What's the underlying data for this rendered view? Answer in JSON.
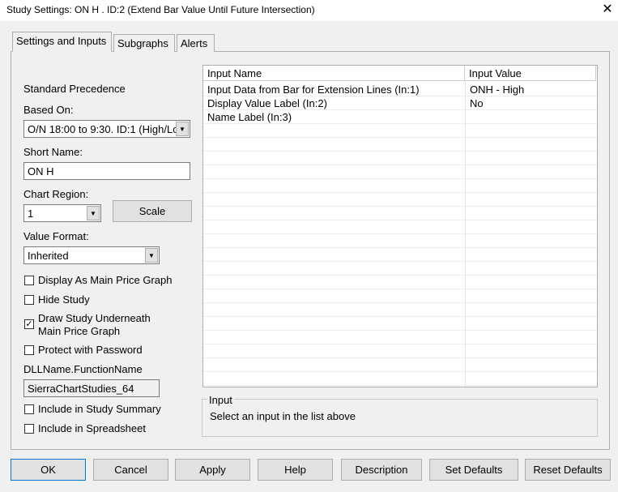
{
  "window": {
    "title": "Study Settings: ON H . ID:2 (Extend Bar Value Until Future Intersection)",
    "close": "✕"
  },
  "tabs": [
    "Settings and Inputs",
    "Subgraphs",
    "Alerts"
  ],
  "left": {
    "standard_precedence": "Standard Precedence",
    "based_on_label": "Based On:",
    "based_on_value": "O/N 18:00 to 9:30. ID:1 (High/Low",
    "short_name_label": "Short Name:",
    "short_name_value": "ON H",
    "chart_region_label": "Chart Region:",
    "chart_region_value": "1",
    "scale": "Scale",
    "value_format_label": "Value Format:",
    "value_format_value": "Inherited",
    "checkboxes": [
      {
        "label": "Display As Main Price Graph",
        "checked": false
      },
      {
        "label": "Hide Study",
        "checked": false
      },
      {
        "label": "Draw Study Underneath\nMain Price Graph",
        "checked": true
      },
      {
        "label": "Protect with Password",
        "checked": false
      }
    ],
    "dll_label": "DLLName.FunctionName",
    "dll_value": "SierraChartStudies_64",
    "checkboxes2": [
      {
        "label": "Include in Study Summary",
        "checked": false
      },
      {
        "label": "Include in Spreadsheet",
        "checked": false
      }
    ]
  },
  "grid": {
    "headers": [
      "Input Name",
      "Input Value"
    ],
    "rows": [
      {
        "name": "Input Data from Bar for Extension Lines  (In:1)",
        "value": "ONH - High"
      },
      {
        "name": "Display Value Label  (In:2)",
        "value": "No"
      },
      {
        "name": "Name Label  (In:3)",
        "value": ""
      }
    ]
  },
  "input_group": {
    "title": "Input",
    "text": "Select an input in the list above"
  },
  "buttons": [
    "OK",
    "Cancel",
    "Apply",
    "Help",
    "Description",
    "Set Defaults",
    "Reset Defaults"
  ]
}
